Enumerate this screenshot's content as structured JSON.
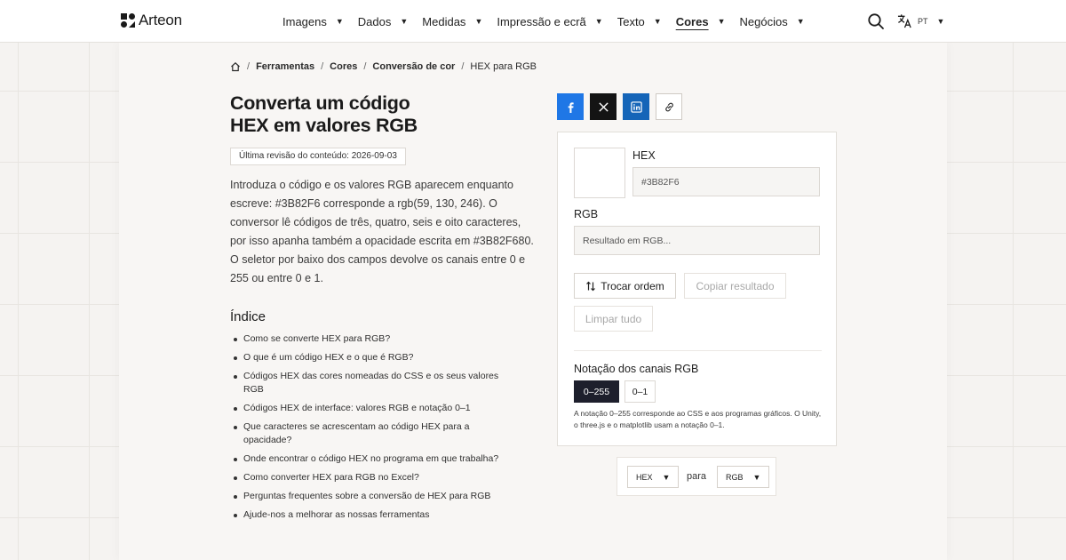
{
  "header": {
    "logo_text": "Arteon",
    "nav": [
      {
        "label": "Imagens",
        "active": false
      },
      {
        "label": "Dados",
        "active": false
      },
      {
        "label": "Medidas",
        "active": false
      },
      {
        "label": "Impressão e ecrã",
        "active": false
      },
      {
        "label": "Texto",
        "active": false
      },
      {
        "label": "Cores",
        "active": true
      },
      {
        "label": "Negócios",
        "active": false
      }
    ],
    "language": "PT",
    "icons": {
      "search": "search-icon",
      "language": "translate-icon",
      "caret": "caret-down-icon"
    }
  },
  "breadcrumb": {
    "home_icon": "home-icon",
    "items": [
      "Ferramentas",
      "Cores",
      "Conversão de cor"
    ],
    "current": "HEX para RGB"
  },
  "article": {
    "title_line1": "Converta um código",
    "title_line2": "HEX em valores RGB",
    "revised": "Última revisão do conteúdo: 2026-09-03",
    "intro": "Introduza o código e os valores RGB aparecem enquanto escreve: #3B82F6 corresponde a rgb(59, 130, 246). O conversor lê códigos de três, quatro, seis e oito caracteres, por isso apanha também a opacidade escrita em #3B82F680. O seletor por baixo dos campos devolve os canais entre 0 e 255 ou entre 0 e 1.",
    "toc_title": "Índice",
    "toc": [
      "Como se converte HEX para RGB?",
      "O que é um código HEX e o que é RGB?",
      "Códigos HEX das cores nomeadas do CSS e os seus valores RGB",
      "Códigos HEX de interface: valores RGB e notação 0–1",
      "Que caracteres se acrescentam ao código HEX para a opacidade?",
      "Onde encontrar o código HEX no programa em que trabalha?",
      "Como converter HEX para RGB no Excel?",
      "Perguntas frequentes sobre a conversão de HEX para RGB",
      "Ajude-nos a melhorar as nossas ferramentas"
    ]
  },
  "share": {
    "icons": [
      "facebook-icon",
      "x-icon",
      "linkedin-icon",
      "link-icon"
    ],
    "colors": {
      "facebook": "#1f77e6",
      "x": "#141414",
      "linkedin": "#1565b8"
    }
  },
  "converter": {
    "hex_label": "HEX",
    "hex_placeholder": "#3B82F6",
    "rgb_label": "RGB",
    "rgb_placeholder": "Resultado em RGB...",
    "swap_label": "Trocar ordem",
    "copy_label": "Copiar resultado",
    "clear_label": "Limpar tudo",
    "notation_label": "Notação dos canais RGB",
    "notation_options": [
      "0–255",
      "0–1"
    ],
    "notation_selected": "0–255",
    "notation_note": "A notação 0–255 corresponde ao CSS e aos programas gráficos. O Unity, o three.js e o matplotlib usam a notação 0–1."
  },
  "format_selector": {
    "from": "HEX",
    "to_word": "para",
    "to": "RGB"
  },
  "colors": {
    "accent_dark": "#1d1f2c",
    "page_bg": "#f5f3f1"
  }
}
